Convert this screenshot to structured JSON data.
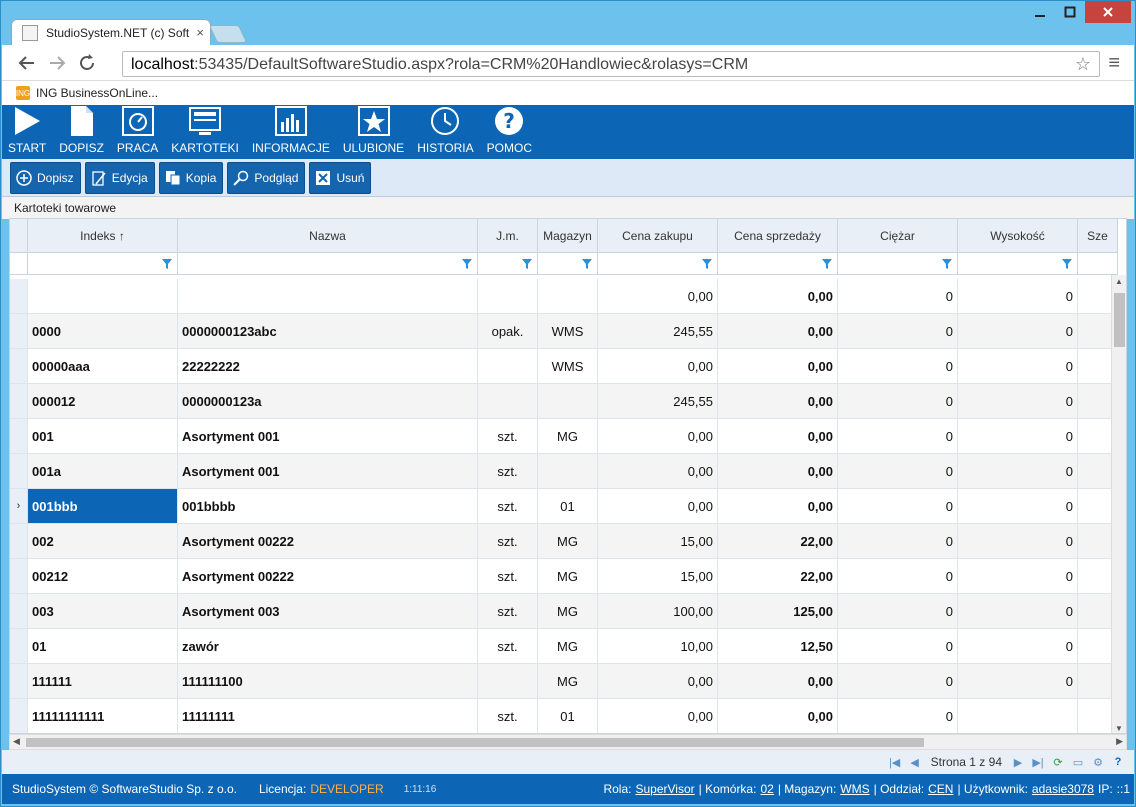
{
  "browser": {
    "tab_title": "StudioSystem.NET (c) Soft",
    "tab_close": "×",
    "url_host": "localhost",
    "url_rest": ":53435/DefaultSoftwareStudio.aspx?rola=CRM%20Handlowiec&rolasys=CRM",
    "bookmark": "ING BusinessOnLine...",
    "back_icon": "back-arrow-icon",
    "forward_icon": "forward-arrow-icon",
    "reload_icon": "reload-icon"
  },
  "ribbon": [
    {
      "label": "START",
      "icon": "play-icon"
    },
    {
      "label": "DOPISZ",
      "icon": "document-icon"
    },
    {
      "label": "PRACA",
      "icon": "dashboard-icon"
    },
    {
      "label": "KARTOTEKI",
      "icon": "monitor-icon"
    },
    {
      "label": "INFORMACJE",
      "icon": "bar-chart-icon"
    },
    {
      "label": "ULUBIONE",
      "icon": "star-icon"
    },
    {
      "label": "HISTORIA",
      "icon": "history-icon"
    },
    {
      "label": "POMOC",
      "icon": "help-icon"
    }
  ],
  "toolbar": [
    {
      "label": "Dopisz",
      "icon": "plus-icon"
    },
    {
      "label": "Edycja",
      "icon": "edit-icon"
    },
    {
      "label": "Kopia",
      "icon": "copy-icon"
    },
    {
      "label": "Podgląd",
      "icon": "magnifier-icon"
    },
    {
      "label": "Usuń",
      "icon": "delete-icon"
    }
  ],
  "section_title": "Kartoteki towarowe",
  "grid": {
    "columns": [
      "Indeks ↑",
      "Nazwa",
      "J.m.",
      "Magazyn",
      "Cena zakupu",
      "Cena sprzedaży",
      "Ciężar",
      "Wysokość",
      "Sze"
    ],
    "rows": [
      [
        "",
        "",
        "",
        "",
        "0,00",
        "0,00",
        "0",
        "0"
      ],
      [
        "0000",
        "0000000123abc",
        "opak.",
        "WMS",
        "245,55",
        "0,00",
        "0",
        "0"
      ],
      [
        "00000aaa",
        "22222222",
        "",
        "WMS",
        "0,00",
        "0,00",
        "0",
        "0"
      ],
      [
        "000012",
        "0000000123a",
        "",
        "",
        "245,55",
        "0,00",
        "0",
        "0"
      ],
      [
        "001",
        "Asortyment 001",
        "szt.",
        "MG",
        "0,00",
        "0,00",
        "0",
        "0"
      ],
      [
        "001a",
        "Asortyment 001",
        "szt.",
        "",
        "0,00",
        "0,00",
        "0",
        "0"
      ],
      [
        "001bbb",
        "001bbbb",
        "szt.",
        "01",
        "0,00",
        "0,00",
        "0",
        "0"
      ],
      [
        "002",
        "Asortyment 00222",
        "szt.",
        "MG",
        "15,00",
        "22,00",
        "0",
        "0"
      ],
      [
        "00212",
        "Asortyment 00222",
        "szt.",
        "MG",
        "15,00",
        "22,00",
        "0",
        "0"
      ],
      [
        "003",
        "Asortyment 003",
        "szt.",
        "MG",
        "100,00",
        "125,00",
        "0",
        "0"
      ],
      [
        "01",
        "zawór",
        "szt.",
        "MG",
        "10,00",
        "12,50",
        "0",
        "0"
      ],
      [
        "111111",
        "111111100",
        "",
        "MG",
        "0,00",
        "0,00",
        "0",
        "0"
      ],
      [
        "11111111111",
        "11111111",
        "szt.",
        "01",
        "0,00",
        "0,00",
        "0",
        ""
      ]
    ],
    "selected_row_index": 6,
    "row_indicator": "›"
  },
  "pager": {
    "text": "Strona 1 z 94",
    "help": "?"
  },
  "status": {
    "copyright": "StudioSystem © SoftwareStudio Sp. z o.o.",
    "license_label": "Licencja:",
    "license_value": "DEVELOPER",
    "time": "1:11:16",
    "role_label": "Rola:",
    "role_value": "SuperVisor",
    "cell_label": "| Komórka:",
    "cell_value": "02",
    "warehouse_label": "| Magazyn:",
    "warehouse_value": "WMS",
    "branch_label": "| Oddział:",
    "branch_value": "CEN",
    "user_label": "| Użytkownik:",
    "user_value": "adasie3078",
    "ip_label": "IP:",
    "ip_value": "::1"
  },
  "colors": {
    "ribbon_blue": "#0c66b5",
    "chrome_blue": "#6cc2ec",
    "license_orange": "#ffb14a"
  }
}
